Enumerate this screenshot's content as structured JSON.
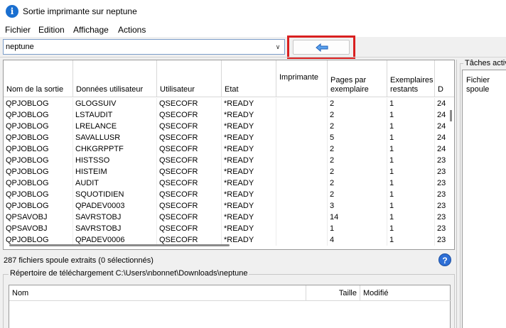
{
  "window": {
    "title": "Sortie imprimante sur neptune"
  },
  "menu": [
    "Fichier",
    "Edition",
    "Affichage",
    "Actions"
  ],
  "system_select": {
    "value": "neptune"
  },
  "toolbar": {
    "back_icon": "arrow-left-icon",
    "accent": "#2e6fd6",
    "highlight_color": "#d92020"
  },
  "spool_table": {
    "columns": [
      "Nom de la sortie",
      "Données utilisateur",
      "Utilisateur",
      "Etat",
      "Imprimante",
      "Pages par exemplaire",
      "Exemplaires restants",
      "D"
    ],
    "rows": [
      [
        "QPJOBLOG",
        "GLOGSUIV",
        "QSECOFR",
        "*READY",
        "",
        "2",
        "1",
        "24"
      ],
      [
        "QPJOBLOG",
        "LSTAUDIT",
        "QSECOFR",
        "*READY",
        "",
        "2",
        "1",
        "24"
      ],
      [
        "QPJOBLOG",
        "LRELANCE",
        "QSECOFR",
        "*READY",
        "",
        "2",
        "1",
        "24"
      ],
      [
        "QPJOBLOG",
        "SAVALLUSR",
        "QSECOFR",
        "*READY",
        "",
        "5",
        "1",
        "24"
      ],
      [
        "QPJOBLOG",
        "CHKGRPPTF",
        "QSECOFR",
        "*READY",
        "",
        "2",
        "1",
        "24"
      ],
      [
        "QPJOBLOG",
        "HISTSSO",
        "QSECOFR",
        "*READY",
        "",
        "2",
        "1",
        "23"
      ],
      [
        "QPJOBLOG",
        "HISTEIM",
        "QSECOFR",
        "*READY",
        "",
        "2",
        "1",
        "23"
      ],
      [
        "QPJOBLOG",
        "AUDIT",
        "QSECOFR",
        "*READY",
        "",
        "2",
        "1",
        "23"
      ],
      [
        "QPJOBLOG",
        "SQUOTIDIEN",
        "QSECOFR",
        "*READY",
        "",
        "2",
        "1",
        "23"
      ],
      [
        "QPJOBLOG",
        "QPADEV0003",
        "QSECOFR",
        "*READY",
        "",
        "3",
        "1",
        "23"
      ],
      [
        "QPSAVOBJ",
        "SAVRSTOBJ",
        "QSECOFR",
        "*READY",
        "",
        "14",
        "1",
        "23"
      ],
      [
        "QPSAVOBJ",
        "SAVRSTOBJ",
        "QSECOFR",
        "*READY",
        "",
        "1",
        "1",
        "23"
      ],
      [
        "QPJOBLOG",
        "QPADEV0006",
        "QSECOFR",
        "*READY",
        "",
        "4",
        "1",
        "23"
      ]
    ]
  },
  "status": {
    "text": "287 fichiers spoule extraits (0 sélectionnés)",
    "help_icon": "help-icon"
  },
  "download": {
    "legend": "Répertoire de téléchargement C:\\Users\\nbonnet\\Downloads\\neptune",
    "columns": [
      "Nom",
      "Taille",
      "Modifié"
    ]
  },
  "active_tasks": {
    "legend": "Tâches actives",
    "column": "Fichier spoule"
  }
}
